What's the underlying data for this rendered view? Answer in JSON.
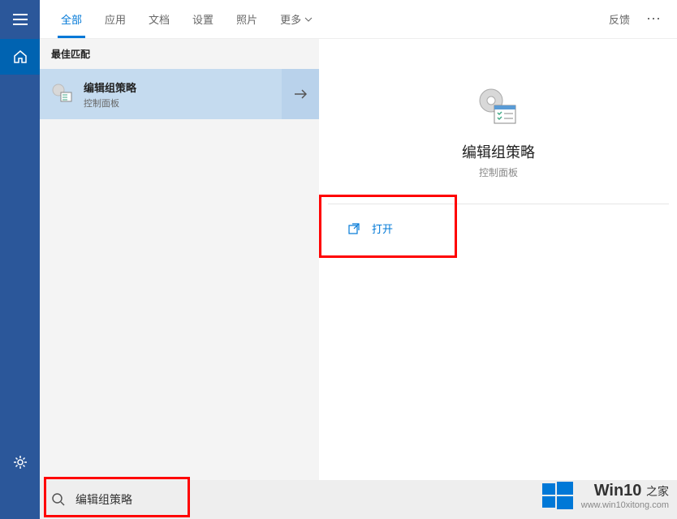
{
  "tabs": {
    "all": "全部",
    "apps": "应用",
    "docs": "文档",
    "settings": "设置",
    "photos": "照片",
    "more": "更多"
  },
  "header": {
    "feedback": "反馈"
  },
  "left": {
    "best_match": "最佳匹配",
    "result_title": "编辑组策略",
    "result_sub": "控制面板"
  },
  "detail": {
    "title": "编辑组策略",
    "sub": "控制面板",
    "open": "打开"
  },
  "search": {
    "value": "编辑组策略"
  },
  "watermark": {
    "brand_main": "Win10",
    "brand_sub": "之家",
    "url": "www.win10xitong.com"
  }
}
